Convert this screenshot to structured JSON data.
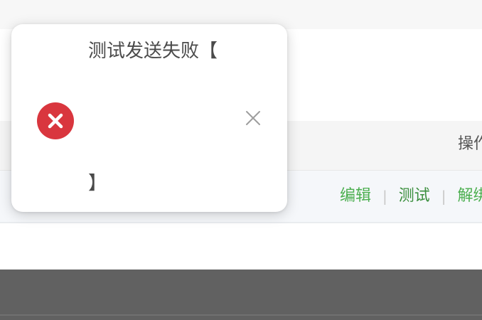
{
  "table": {
    "header_ops": "操作",
    "row": {
      "actions": [
        {
          "label": "编辑"
        },
        {
          "label": "测试"
        },
        {
          "label": "解绑"
        }
      ]
    }
  },
  "toast": {
    "title": "测试发送失败【",
    "closing_bracket": "】",
    "status_icon": "error-circle-x-icon",
    "close_icon": "close-x-icon",
    "colors": {
      "error": "#d9363e",
      "close": "#9e9e9e"
    }
  },
  "colors": {
    "link_green": "#4caf50",
    "overlay_dark": "#616161"
  }
}
